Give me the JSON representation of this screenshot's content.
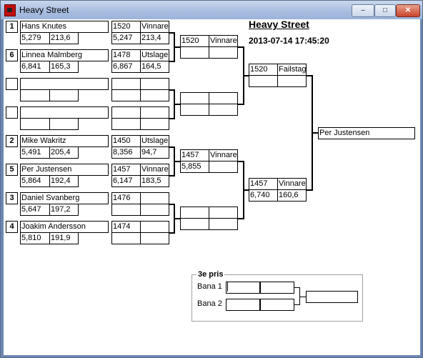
{
  "window": {
    "title": "Heavy Street",
    "buttons": {
      "minimize": "–",
      "maximize": "□",
      "close": "✕"
    }
  },
  "event": {
    "title": "Heavy Street",
    "datetime": "2013-07-14 17:45:20"
  },
  "round1": [
    {
      "seed": "1",
      "name": "Hans Knutes",
      "rt": "5,279",
      "speed": "213,6",
      "r2_id": "1520",
      "r2_status": "Vinnare",
      "r2_time": "5,247",
      "r2_speed": "213,4"
    },
    {
      "seed": "6",
      "name": "Linnea Malmberg",
      "rt": "6,841",
      "speed": "165,3",
      "r2_id": "1478",
      "r2_status": "Utslagen",
      "r2_time": "6,867",
      "r2_speed": "164,5"
    },
    {
      "seed": "",
      "name": "",
      "rt": "",
      "speed": "",
      "r2_id": "",
      "r2_status": "",
      "r2_time": "",
      "r2_speed": ""
    },
    {
      "seed": "",
      "name": "",
      "rt": "",
      "speed": "",
      "r2_id": "",
      "r2_status": "",
      "r2_time": "",
      "r2_speed": ""
    },
    {
      "seed": "2",
      "name": "Mike Wakritz",
      "rt": "5,491",
      "speed": "205,4",
      "r2_id": "1450",
      "r2_status": "Utslagen",
      "r2_time": "8,356",
      "r2_speed": "94,7"
    },
    {
      "seed": "5",
      "name": "Per Justensen",
      "rt": "5,864",
      "speed": "192,4",
      "r2_id": "1457",
      "r2_status": "Vinnare",
      "r2_time": "6,147",
      "r2_speed": "183,5"
    },
    {
      "seed": "3",
      "name": "Daniel Svanberg",
      "rt": "5,647",
      "speed": "197,2",
      "r2_id": "1476",
      "r2_status": "",
      "r2_time": "",
      "r2_speed": ""
    },
    {
      "seed": "4",
      "name": "Joakim Andersson",
      "rt": "5,810",
      "speed": "191,9",
      "r2_id": "1474",
      "r2_status": "",
      "r2_time": "",
      "r2_speed": ""
    }
  ],
  "round2": [
    {
      "id": "1520",
      "status": "Vinnare",
      "time": "",
      "speed": ""
    },
    {
      "id": "",
      "status": "",
      "time": "",
      "speed": ""
    },
    {
      "id": "1457",
      "status": "Vinnare",
      "time": "5,855",
      "speed": ""
    },
    {
      "id": "",
      "status": "",
      "time": "",
      "speed": ""
    }
  ],
  "semis": [
    {
      "id": "1520",
      "status": "Failstage",
      "time": "",
      "speed": ""
    },
    {
      "id": "1457",
      "status": "Vinnare",
      "time": "6,740",
      "speed": "160,6"
    }
  ],
  "final": {
    "winner": "Per Justensen"
  },
  "third_place": {
    "label": "3e pris",
    "lanes": [
      "Bana 1",
      "Bana 2"
    ],
    "result": ""
  }
}
